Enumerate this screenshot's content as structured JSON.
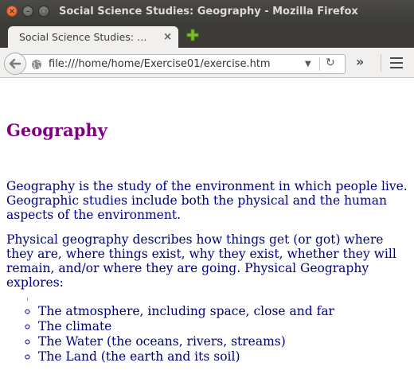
{
  "window": {
    "title": "Social Science Studies: Geography - Mozilla Firefox"
  },
  "tabs": [
    {
      "label": "Social Science Studies: Geography",
      "close_label": "×",
      "active": true
    }
  ],
  "navbar": {
    "url": "file:///home/home/Exercise01/exercise.htm",
    "overflow_label": "»"
  },
  "page": {
    "heading": "Geography",
    "paragraphs": [
      "Geography is the study of the environment in which people live. Geographic studies include both the physical and the human aspects of the environment.",
      "Physical geography describes how things get (or got) where they are, where things exist, why they exist, whether they will remain, and/or where they are going. Physical Geography explores:"
    ],
    "list_items": [
      "The atmosphere, including space, close and far",
      "The climate",
      "The Water (the oceans, rivers, streams)",
      "The Land (the earth and its soil)"
    ]
  },
  "colors": {
    "heading": "#800080",
    "body_text": "#000080",
    "titlebar": "#3c3b37",
    "close_button": "#e2561e"
  },
  "icons": [
    "close-icon",
    "minimize-icon",
    "maximize-icon",
    "new-tab-icon",
    "back-arrow-icon",
    "globe-icon",
    "dropdown-icon",
    "reload-icon",
    "hamburger-menu-icon"
  ]
}
